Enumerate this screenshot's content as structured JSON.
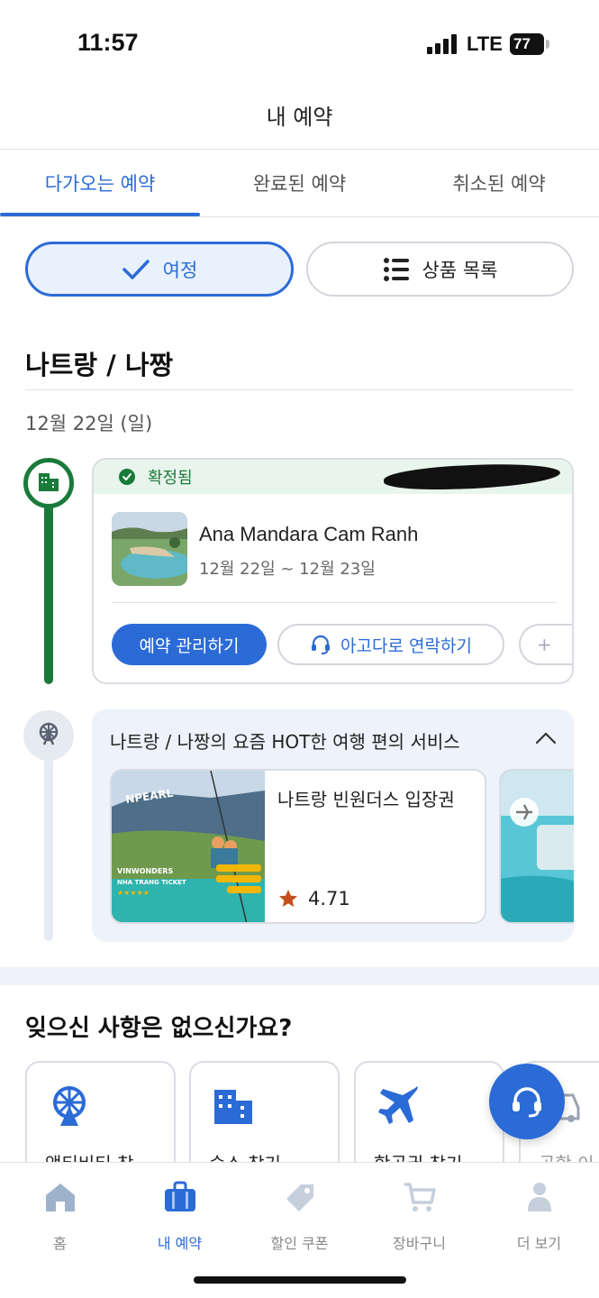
{
  "status_bar": {
    "time": "11:57",
    "network": "LTE",
    "battery": "77"
  },
  "header": {
    "title": "내 예약"
  },
  "tabs": [
    {
      "label": "다가오는 예약",
      "active": true
    },
    {
      "label": "완료된 예약",
      "active": false
    },
    {
      "label": "취소된 예약",
      "active": false
    }
  ],
  "view_toggle": {
    "trip_label": "여정",
    "list_label": "상품 목록",
    "selected": "여정"
  },
  "trip": {
    "city": "나트랑 / 나짱",
    "date": "12월 22일 (일)",
    "booking": {
      "status": "확정됨",
      "hotel_name": "Ana Mandara Cam Ranh",
      "dates": "12월 22일 ~ 12월 23일",
      "manage_label": "예약 관리하기",
      "contact_label": "아고다로 연락하기",
      "more_label": "+"
    },
    "promo": {
      "title": "나트랑 / 나짱의 요즘 HOT한 여행 편의 서비스",
      "product": {
        "name": "나트랑 빈원더스 입장권",
        "rating": "4.71",
        "image_text_1": "VINWONDERS",
        "image_text_2": "NHA TRANG TICKET",
        "image_sign": "NPEARL"
      }
    }
  },
  "forgot": {
    "title": "잊으신 사항은 없으신가요?",
    "items": [
      {
        "label": "액티비티 찾",
        "icon": "ferris-wheel-icon"
      },
      {
        "label": "숙소 찾기",
        "icon": "building-icon"
      },
      {
        "label": "항공권 찾기",
        "icon": "airplane-icon"
      },
      {
        "label": "공항 이",
        "icon": "car-icon"
      }
    ]
  },
  "bottom_nav": [
    {
      "label": "홈",
      "icon": "home-icon",
      "active": false
    },
    {
      "label": "내 예약",
      "icon": "suitcase-icon",
      "active": true
    },
    {
      "label": "할인 쿠폰",
      "icon": "tag-icon",
      "active": false
    },
    {
      "label": "장바구니",
      "icon": "cart-icon",
      "active": false
    },
    {
      "label": "더 보기",
      "icon": "person-icon",
      "active": false
    }
  ],
  "colors": {
    "primary": "#2b6bd6",
    "confirmed_green": "#1a7a3a",
    "confirmed_bg": "#e8f5ec",
    "panel_bg": "#eef2fa"
  }
}
